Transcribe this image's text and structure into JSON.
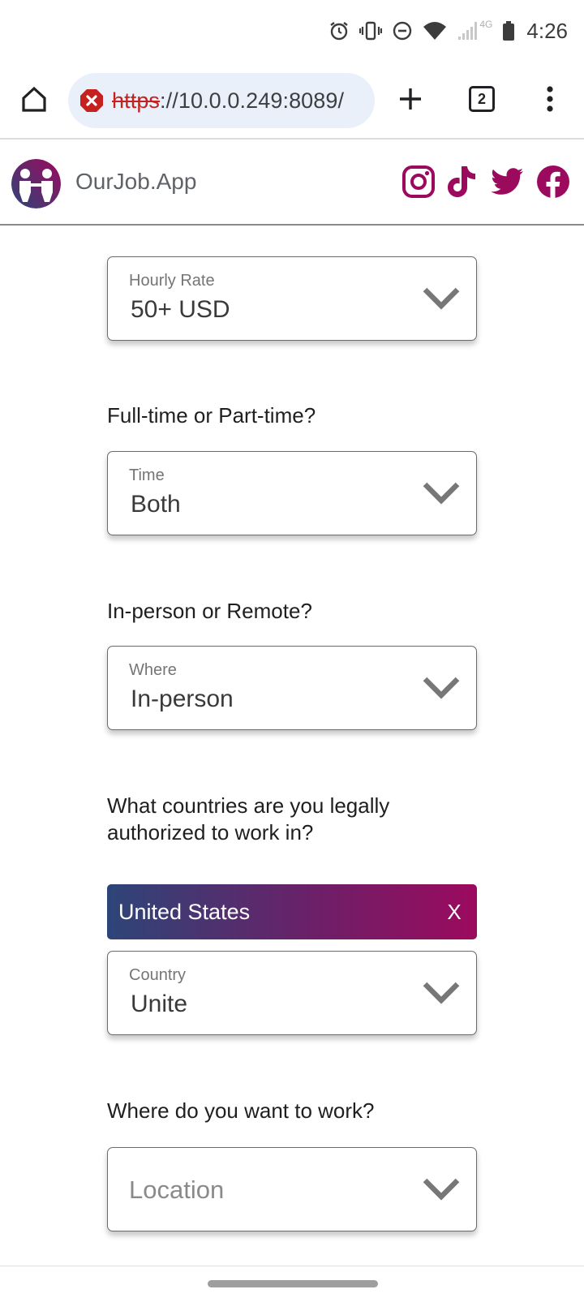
{
  "status_bar": {
    "time": "4:26",
    "network": "4G",
    "icons": [
      "alarm-icon",
      "vibrate-icon",
      "do-not-disturb-icon",
      "wifi-icon",
      "cell-signal-icon",
      "battery-icon"
    ]
  },
  "browser": {
    "url_scheme": "https",
    "url_rest": "://10.0.0.249:8089/",
    "tab_count": "2",
    "icons": [
      "home-icon",
      "not-secure-icon",
      "plus-icon",
      "tabs-icon",
      "more-vert-icon"
    ]
  },
  "site": {
    "brand": "OurJob.App",
    "social_icons": [
      "instagram-icon",
      "tiktok-icon",
      "twitter-icon",
      "facebook-icon"
    ],
    "colors": {
      "brand": "#9c0a5e",
      "gradient_start": "#2d4578",
      "gradient_end": "#9c0a5e"
    }
  },
  "form": {
    "hourly_rate": {
      "label": "Hourly Rate",
      "value": "50+ USD"
    },
    "time_question": "Full-time or Part-time?",
    "time": {
      "label": "Time",
      "value": "Both"
    },
    "where_question": "In-person or Remote?",
    "where": {
      "label": "Where",
      "value": "In-person"
    },
    "countries_question": "What countries are you legally authorized to work in?",
    "selected_country": {
      "label": "United States",
      "remove": "X"
    },
    "country": {
      "label": "Country",
      "value": "Unite"
    },
    "location_question": "Where do you want to work?",
    "location": {
      "placeholder": "Location"
    }
  }
}
